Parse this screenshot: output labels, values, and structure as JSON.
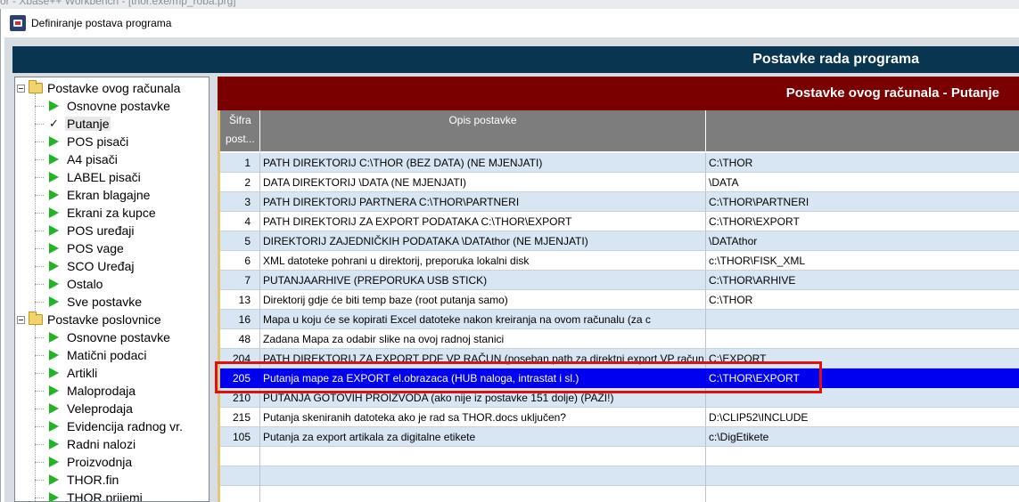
{
  "background_title": "or - Xbase++ Workbench - [thor.exe/mp_roba.prg]",
  "window": {
    "title": "Definiranje postava programa"
  },
  "header": {
    "title": "Postavke rada programa"
  },
  "tree": {
    "groups": [
      {
        "label": "Postavke ovog računala",
        "items": [
          {
            "label": "Osnovne postavke",
            "icon": "arrow-right-icon"
          },
          {
            "label": "Putanje",
            "icon": "check-icon",
            "selected": true
          },
          {
            "label": "POS pisači",
            "icon": "arrow-right-icon"
          },
          {
            "label": "A4 pisači",
            "icon": "arrow-right-icon"
          },
          {
            "label": "LABEL pisači",
            "icon": "arrow-right-icon"
          },
          {
            "label": "Ekran blagajne",
            "icon": "arrow-right-icon"
          },
          {
            "label": "Ekrani za kupce",
            "icon": "arrow-right-icon"
          },
          {
            "label": "POS uređaji",
            "icon": "arrow-right-icon"
          },
          {
            "label": "POS vage",
            "icon": "arrow-right-icon"
          },
          {
            "label": "SCO Uređaj",
            "icon": "arrow-right-icon"
          },
          {
            "label": "Ostalo",
            "icon": "arrow-right-icon"
          },
          {
            "label": "Sve postavke",
            "icon": "arrow-right-icon"
          }
        ]
      },
      {
        "label": "Postavke poslovnice",
        "items": [
          {
            "label": "Osnovne postavke",
            "icon": "arrow-right-icon"
          },
          {
            "label": "Matični podaci",
            "icon": "arrow-right-icon"
          },
          {
            "label": "Artikli",
            "icon": "arrow-right-icon"
          },
          {
            "label": "Maloprodaja",
            "icon": "arrow-right-icon"
          },
          {
            "label": "Veleprodaja",
            "icon": "arrow-right-icon"
          },
          {
            "label": "Evidencija radnog vr.",
            "icon": "arrow-right-icon"
          },
          {
            "label": "Radni nalozi",
            "icon": "arrow-right-icon"
          },
          {
            "label": "Proizvodnja",
            "icon": "arrow-right-icon"
          },
          {
            "label": "THOR.fin",
            "icon": "arrow-right-icon"
          },
          {
            "label": "THOR.prijemi",
            "icon": "arrow-right-icon"
          }
        ]
      }
    ]
  },
  "panel": {
    "title": "Postavke ovog računala - Putanje"
  },
  "table": {
    "headers": {
      "code_line1": "Šifra",
      "code_line2": "post...",
      "description": "Opis postavke",
      "value": ""
    },
    "rows": [
      {
        "code": "1",
        "description": "PATH DIREKTORIJ C:\\THOR (BEZ DATA) (NE MJENJATI)",
        "value": "C:\\THOR"
      },
      {
        "code": "2",
        "description": "DATA DIREKTORIJ \\DATA (NE MJENJATI)",
        "value": "\\DATA"
      },
      {
        "code": "3",
        "description": "PATH DIREKTORIJ PARTNERA C:\\THOR\\PARTNERI",
        "value": "C:\\THOR\\PARTNERI"
      },
      {
        "code": "4",
        "description": "PATH DIREKTORIJ ZA EXPORT PODATAKA C:\\THOR\\EXPORT",
        "value": "C:\\THOR\\EXPORT"
      },
      {
        "code": "5",
        "description": "DIREKTORIJ ZAJEDNIČKIH PODATAKA \\DATAthor (NE MJENJATI)",
        "value": "\\DATAthor"
      },
      {
        "code": "6",
        "description": "XML datoteke pohrani u direktorij, preporuka lokalni disk",
        "value": "c:\\THOR\\FISK_XML"
      },
      {
        "code": "7",
        "description": "PUTANJAARHIVE (PREPORUKA USB STICK)",
        "value": "C:\\THOR\\ARHIVE"
      },
      {
        "code": "13",
        "description": "Direktorij gdje će biti temp baze (root putanja samo)",
        "value": "C:\\THOR"
      },
      {
        "code": "16",
        "description": "Mapa u koju će se kopirati Excel datoteke nakon kreiranja na ovom računalu (za c",
        "value": ""
      },
      {
        "code": "48",
        "description": "Zadana Mapa za odabir slike na ovoj radnoj stanici",
        "value": ""
      },
      {
        "code": "204",
        "description": "PATH DIREKTORIJ ZA EXPORT PDF VP RAČUN (poseban path za direktni export VP račun",
        "value": "C:\\EXPORT"
      },
      {
        "code": "205",
        "description": "Putanja mape za EXPORT el.obrazaca (HUB naloga, intrastat i sl.)",
        "value": "C:\\THOR\\EXPORT",
        "selected": true
      },
      {
        "code": "210",
        "description": "PUTANJA GOTOVIH PROIZVODA (ako nije iz postavke 151 dolje) (PAZI!)",
        "value": ""
      },
      {
        "code": "215",
        "description": "Putanja skeniranih datoteka ako je rad sa THOR.docs uključen?",
        "value": "D:\\CLIP52\\INCLUDE"
      },
      {
        "code": "105",
        "description": "Putanja za export artikala za digitalne etikete",
        "value": "c:\\DigEtikete"
      }
    ]
  },
  "colors": {
    "header_bg": "#0a3550",
    "panel_header_bg": "#7a0000",
    "row_alt": "#d8e6f3",
    "row_selected": "#0000f0",
    "annotation_box": "#e01010",
    "tree_arrow": "#23b423"
  }
}
